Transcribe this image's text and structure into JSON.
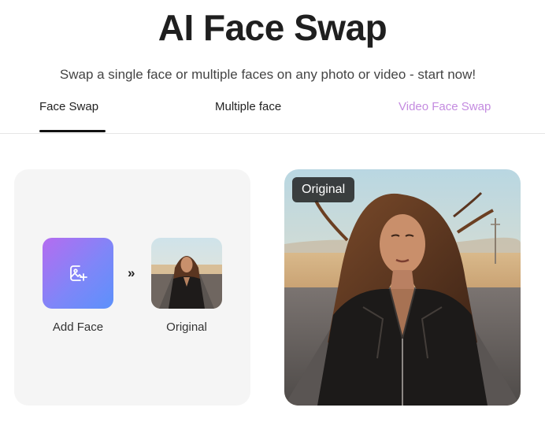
{
  "header": {
    "title": "AI Face Swap",
    "subtitle": "Swap a single face or multiple faces on any photo or video - start now!"
  },
  "tabs": [
    {
      "label": "Face Swap",
      "active": true
    },
    {
      "label": "Multiple face",
      "active": false
    },
    {
      "label": "Video Face Swap",
      "active": false,
      "color": "#c48be0"
    }
  ],
  "upload": {
    "add_face_label": "Add Face",
    "original_label": "Original",
    "arrow_glyph": "»",
    "add_icon": "image-plus-icon"
  },
  "preview": {
    "badge_label": "Original"
  },
  "colors": {
    "gradient_start": "#b56cf0",
    "gradient_end": "#5c91fb",
    "accent_tab": "#c48be0"
  }
}
